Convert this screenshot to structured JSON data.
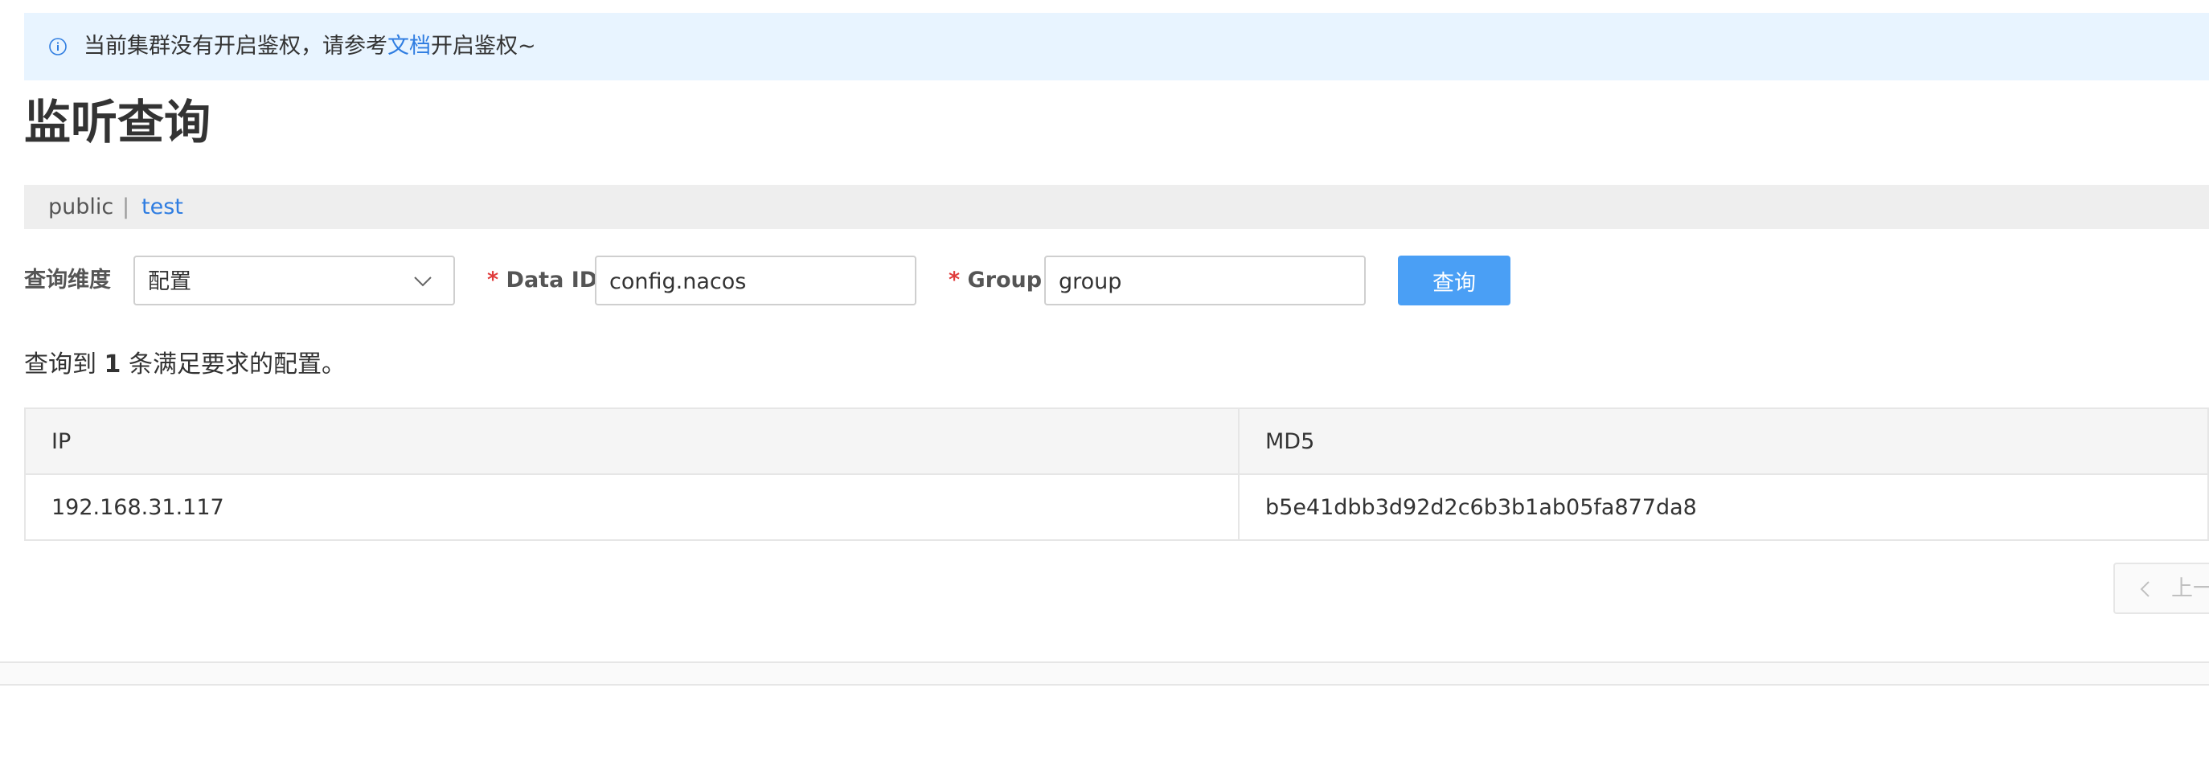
{
  "notice": {
    "icon": "info-icon",
    "text_before": "当前集群没有开启鉴权，请参考",
    "link_text": "文档",
    "text_after": "开启鉴权~"
  },
  "page": {
    "title": "监听查询"
  },
  "namespaces": {
    "items": [
      "public",
      "test"
    ],
    "separator": "|",
    "active": "test"
  },
  "form": {
    "dimension_label": "查询维度",
    "dimension_value": "配置",
    "required_mark": "*",
    "dataid_label": "Data ID",
    "dataid_value": "config.nacos",
    "group_label": "Group",
    "group_value": "group",
    "query_button": "查询"
  },
  "result": {
    "prefix": "查询到",
    "count": "1",
    "suffix": "条满足要求的配置。"
  },
  "table": {
    "columns": [
      "IP",
      "MD5"
    ],
    "rows": [
      {
        "ip": "192.168.31.117",
        "md5": "b5e41dbb3d92d2c6b3b1ab05fa877da8"
      }
    ]
  },
  "pagination": {
    "prev_label": "上一"
  },
  "colors": {
    "accent": "#4a9ff5",
    "link": "#2f7de1",
    "required": "#e03c3c",
    "notice_bg": "#e8f4ff"
  }
}
